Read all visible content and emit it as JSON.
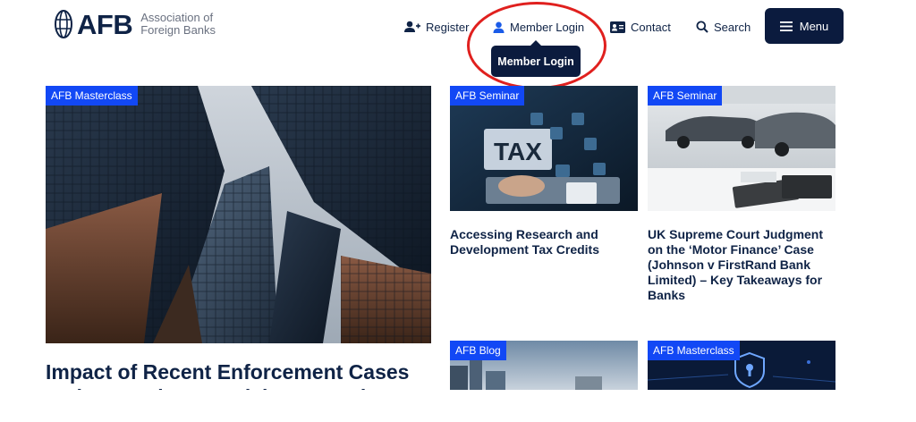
{
  "logo": {
    "mark": "AFB",
    "line1": "Association of",
    "line2": "Foreign Banks"
  },
  "nav": {
    "register": "Register",
    "member_login": "Member Login",
    "contact": "Contact",
    "search": "Search",
    "menu": "Menu"
  },
  "dropdown": {
    "member_login": "Member Login"
  },
  "featured": {
    "badge": "AFB Masterclass",
    "title": "Impact of Recent Enforcement Cases and Supervisory Activity on Senior Ma"
  },
  "cards": [
    {
      "badge": "AFB Seminar",
      "title": "Accessing Research and Development Tax Credits",
      "image_text": "TAX"
    },
    {
      "badge": "AFB Seminar",
      "title": "UK Supreme Court Judgment on the ‘Motor Finance’ Case (Johnson v FirstRand Bank Limited) – Key Takeaways for Banks"
    },
    {
      "badge": "AFB Blog",
      "title": ""
    },
    {
      "badge": "AFB Masterclass",
      "title": ""
    }
  ],
  "colors": {
    "navy": "#0b1b3e",
    "badge_blue": "#1248f5",
    "annotation_red": "#e0201e",
    "text": "#0f2346"
  }
}
